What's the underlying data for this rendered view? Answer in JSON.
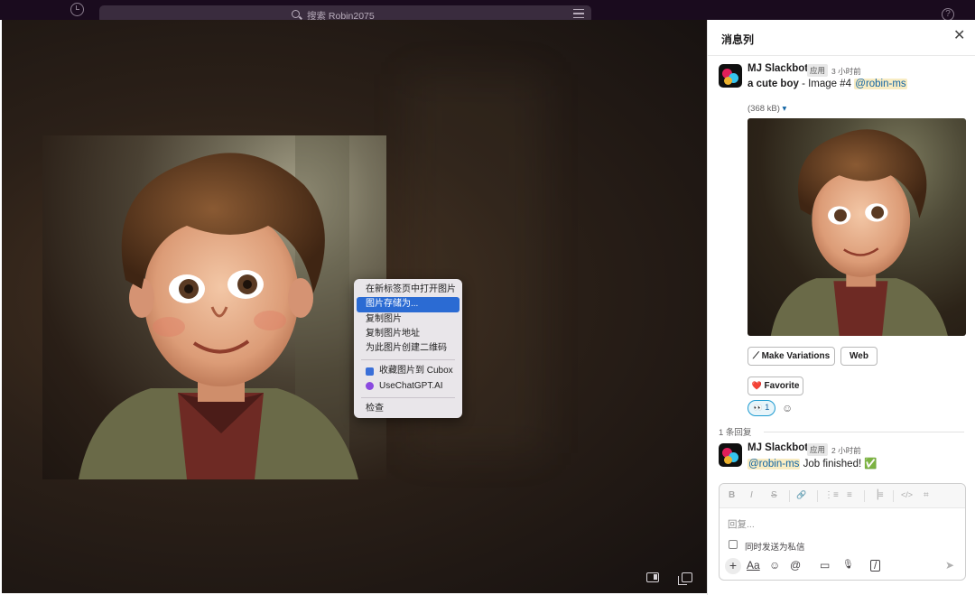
{
  "topbar": {
    "search_placeholder": "搜索 Robin2075",
    "history_icon": "clock-icon",
    "help_icon": "help-icon",
    "help_glyph": "?"
  },
  "viewer": {
    "image_alt": "a cute boy",
    "context_menu": {
      "items": [
        {
          "label": "在新标签页中打开图片",
          "selected": false
        },
        {
          "label": "图片存储为...",
          "selected": true
        },
        {
          "label": "复制图片",
          "selected": false
        },
        {
          "label": "复制图片地址",
          "selected": false
        },
        {
          "label": "为此图片创建二维码",
          "selected": false
        }
      ],
      "ext_items": [
        {
          "label": "收藏图片到 Cubox",
          "icon": "cubox-icon"
        },
        {
          "label": "UseChatGPT.AI",
          "icon": "sparkle-icon"
        }
      ],
      "inspect": "检查"
    }
  },
  "thread": {
    "title": "消息列",
    "close_glyph": "✕",
    "message1": {
      "author": "MJ Slackbot",
      "app_tag": "应用",
      "time": "3 小时前",
      "text_bold": "a cute boy",
      "text_rest": " - Image #4 ",
      "mention": "@robin-ms",
      "file_size": "(368 kB)",
      "caret": "▾",
      "buttons": {
        "variations": "Make Variations",
        "variations_glyph": "⟋",
        "web": "Web",
        "favorite": "Favorite",
        "favorite_glyph": "❤️"
      },
      "reaction_emoji": "👀",
      "reaction_count": "1",
      "add_reaction_glyph": "☺"
    },
    "reply_count": "1 条回复",
    "message2": {
      "author": "MJ Slackbot",
      "app_tag": "应用",
      "time": "2 小时前",
      "mention": "@robin-ms",
      "text": " Job finished! ",
      "emoji": "✅"
    },
    "composer": {
      "format_buttons": [
        "B",
        "I",
        "S",
        "🔗",
        "⋮≡",
        "≡",
        "▕≡",
        "</>",
        "⌗"
      ],
      "placeholder": "回复...",
      "also_send_dm": "同时发送为私信",
      "tools": [
        "+",
        "Aa",
        "☺",
        "@",
        "▭",
        "🎙",
        "/"
      ],
      "send_glyph": "➤"
    }
  },
  "colors": {
    "selected_menu": "#2b6bd3",
    "mention_bg": "#f8ecc3",
    "mention_fg": "#1264a3",
    "titlebar": "#1a0b1e"
  }
}
